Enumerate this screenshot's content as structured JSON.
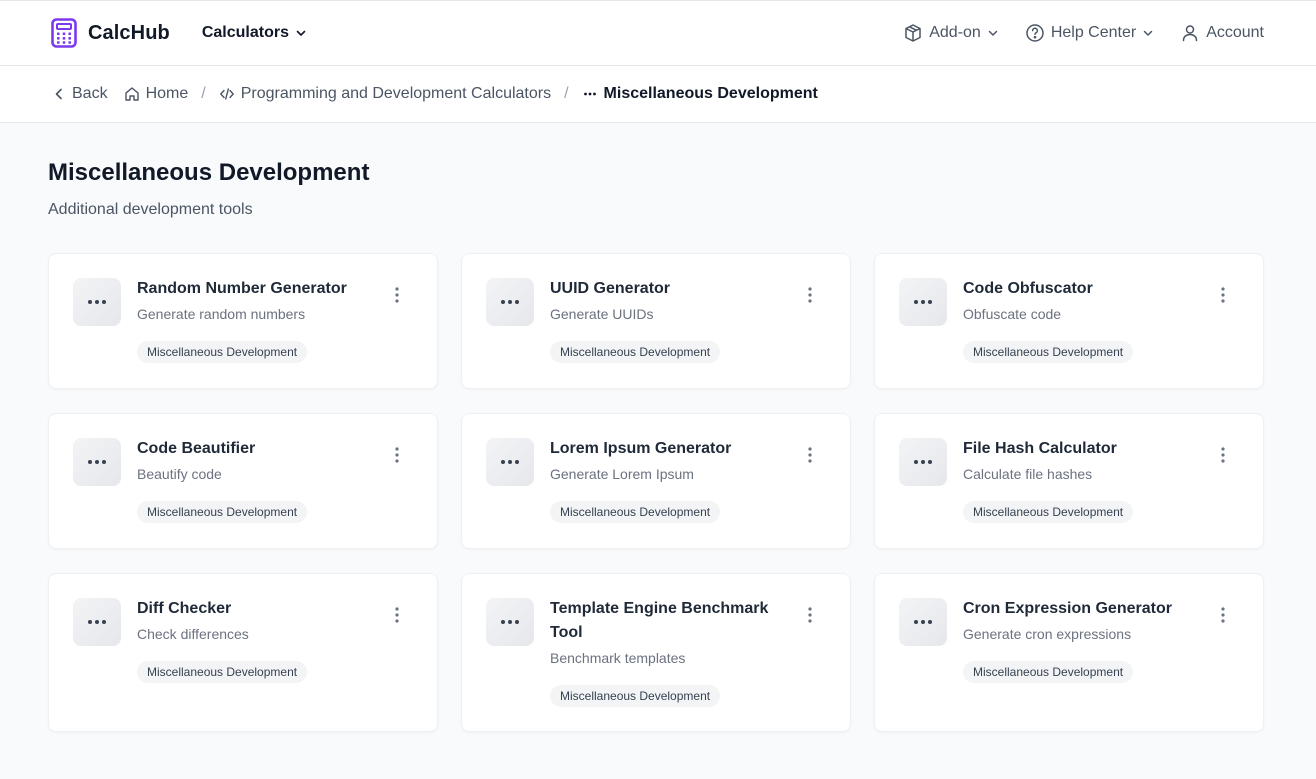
{
  "header": {
    "brand": "CalcHub",
    "nav_calculators": "Calculators",
    "addon": "Add-on",
    "help_center": "Help Center",
    "account": "Account",
    "brand_color": "#7c3aed"
  },
  "breadcrumb": {
    "back": "Back",
    "home": "Home",
    "parent": "Programming and Development Calculators",
    "current": "Miscellaneous Development"
  },
  "page": {
    "title": "Miscellaneous Development",
    "subtitle": "Additional development tools"
  },
  "cards": [
    {
      "title": "Random Number Generator",
      "description": "Generate random numbers",
      "tag": "Miscellaneous Development",
      "icon": "more-horizontal-icon"
    },
    {
      "title": "UUID Generator",
      "description": "Generate UUIDs",
      "tag": "Miscellaneous Development",
      "icon": "more-horizontal-icon"
    },
    {
      "title": "Code Obfuscator",
      "description": "Obfuscate code",
      "tag": "Miscellaneous Development",
      "icon": "more-horizontal-icon"
    },
    {
      "title": "Code Beautifier",
      "description": "Beautify code",
      "tag": "Miscellaneous Development",
      "icon": "more-horizontal-icon"
    },
    {
      "title": "Lorem Ipsum Generator",
      "description": "Generate Lorem Ipsum",
      "tag": "Miscellaneous Development",
      "icon": "more-horizontal-icon"
    },
    {
      "title": "File Hash Calculator",
      "description": "Calculate file hashes",
      "tag": "Miscellaneous Development",
      "icon": "more-horizontal-icon"
    },
    {
      "title": "Diff Checker",
      "description": "Check differences",
      "tag": "Miscellaneous Development",
      "icon": "more-horizontal-icon"
    },
    {
      "title": "Template Engine Benchmark Tool",
      "description": "Benchmark templates",
      "tag": "Miscellaneous Development",
      "icon": "more-horizontal-icon"
    },
    {
      "title": "Cron Expression Generator",
      "description": "Generate cron expressions",
      "tag": "Miscellaneous Development",
      "icon": "more-horizontal-icon"
    }
  ]
}
